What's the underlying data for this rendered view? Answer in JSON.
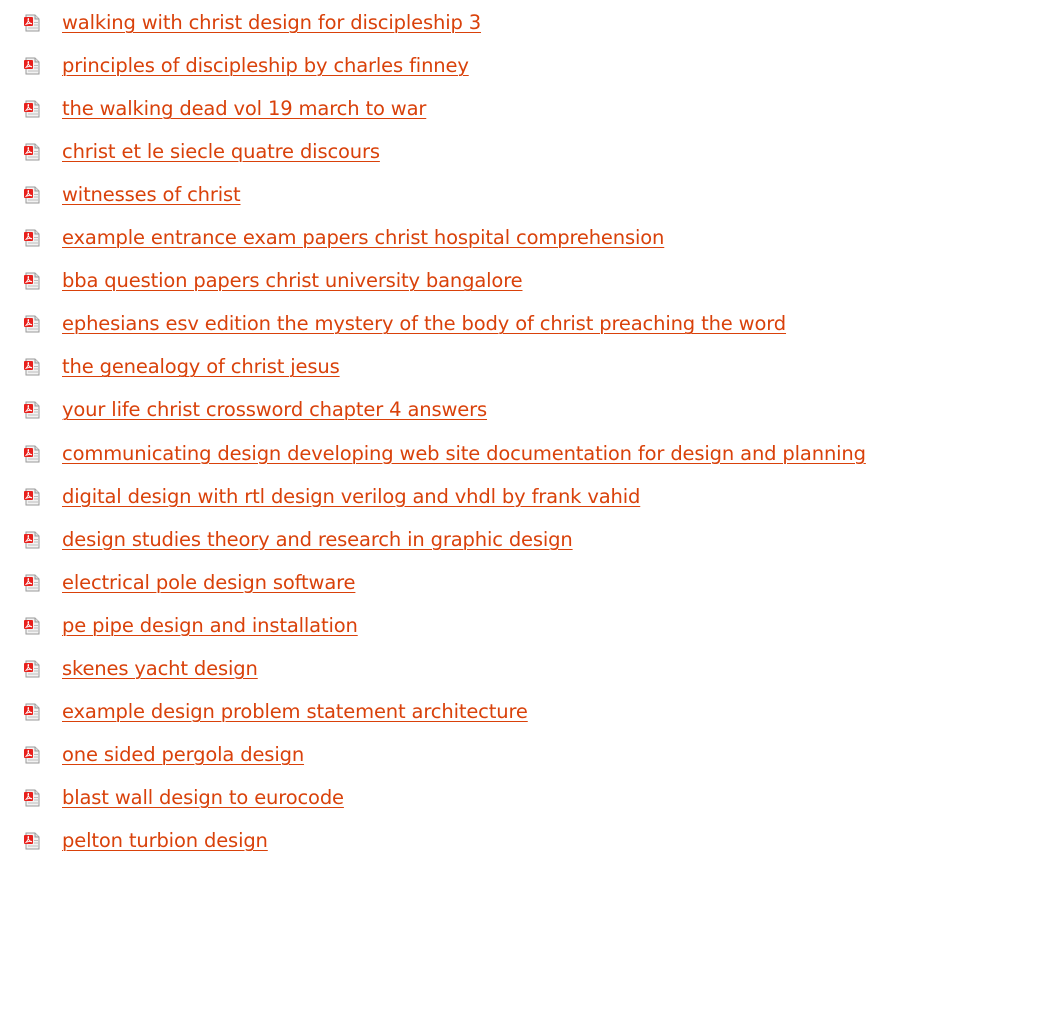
{
  "icon": {
    "name": "pdf-file-icon",
    "accent_color": "#e8201c",
    "paper_color": "#f2f2f2"
  },
  "link_color": "#d9410a",
  "items": [
    {
      "label": "walking with christ design for discipleship 3"
    },
    {
      "label": "principles of discipleship by charles finney"
    },
    {
      "label": "the walking dead vol 19 march to war"
    },
    {
      "label": "christ et le siecle quatre discours"
    },
    {
      "label": "witnesses of christ"
    },
    {
      "label": "example entrance exam papers christ hospital comprehension"
    },
    {
      "label": "bba question papers christ university bangalore"
    },
    {
      "label": "ephesians esv edition the mystery of the body of christ preaching the word"
    },
    {
      "label": "the genealogy of christ jesus"
    },
    {
      "label": "your life christ crossword chapter 4 answers"
    },
    {
      "label": "communicating design developing web site documentation for design and planning"
    },
    {
      "label": "digital design with rtl design verilog and vhdl by frank vahid"
    },
    {
      "label": "design studies theory and research in graphic design"
    },
    {
      "label": "electrical pole design software"
    },
    {
      "label": "pe pipe design and installation"
    },
    {
      "label": "skenes yacht design"
    },
    {
      "label": "example design problem statement architecture"
    },
    {
      "label": "one sided pergola design"
    },
    {
      "label": "blast wall design to eurocode"
    },
    {
      "label": "pelton turbion design"
    }
  ]
}
